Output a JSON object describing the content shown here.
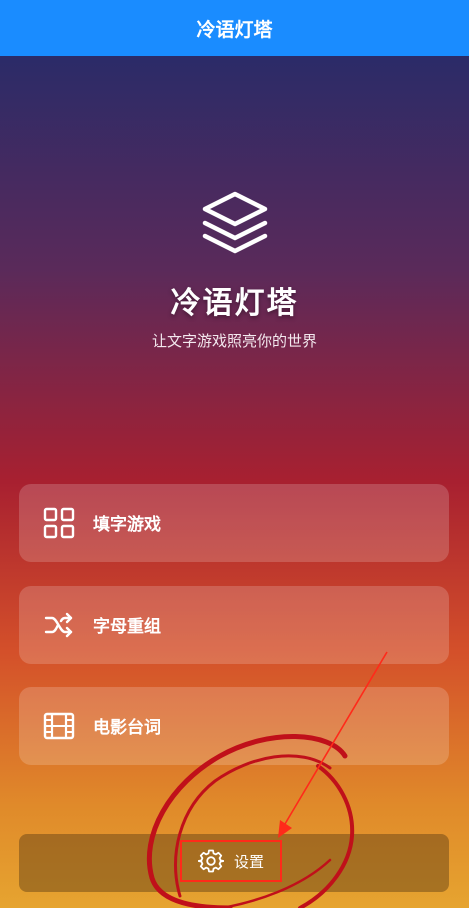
{
  "app_bar": {
    "title": "冷语灯塔"
  },
  "hero": {
    "logo_icon": "layers-icon",
    "title": "冷语灯塔",
    "subtitle": "让文字游戏照亮你的世界"
  },
  "menu": [
    {
      "label": "填字游戏",
      "icon": "grid-icon"
    },
    {
      "label": "字母重组",
      "icon": "shuffle-icon"
    },
    {
      "label": "电影台词",
      "icon": "film-icon"
    }
  ],
  "settings": {
    "label": "设置",
    "icon": "gear-icon"
  },
  "colors": {
    "app_bar": "#1a8cff",
    "annotation_red": "#c0101a",
    "highlight_box": "#ff2a1a"
  }
}
